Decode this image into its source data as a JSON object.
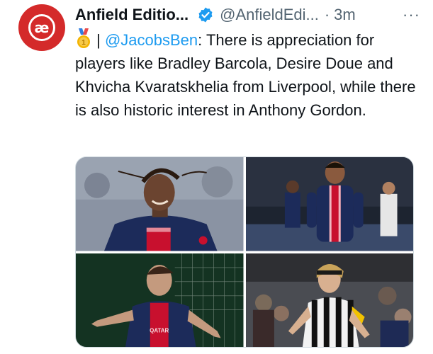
{
  "tweet": {
    "display_name": "Anfield Editio...",
    "handle": "@AnfieldEdi...",
    "separator": "·",
    "time": "3m",
    "more": "···",
    "avatar_text": "æ",
    "medal_label": "1",
    "text_prefix": " | ",
    "mention": "@JacobsBen",
    "text_body": ": There is appreciation for players like Bradley Barcola, Desire Doue and Khvicha Kvaratskhelia from Liverpool, while there is also historic interest in Anthony Gordon."
  },
  "colors": {
    "brand": "#d42a2a",
    "link": "#1d9bf0",
    "secondary_text": "#536471",
    "psg_navy": "#1c2b5a",
    "psg_red": "#c8102e",
    "newcastle_black": "#111111"
  },
  "icons": [
    "verified-badge-icon",
    "more-options-icon",
    "medal-icon"
  ],
  "media": {
    "photos": [
      {
        "subject": "photo-player-1"
      },
      {
        "subject": "photo-player-2"
      },
      {
        "subject": "photo-player-3"
      },
      {
        "subject": "photo-player-4"
      }
    ]
  }
}
